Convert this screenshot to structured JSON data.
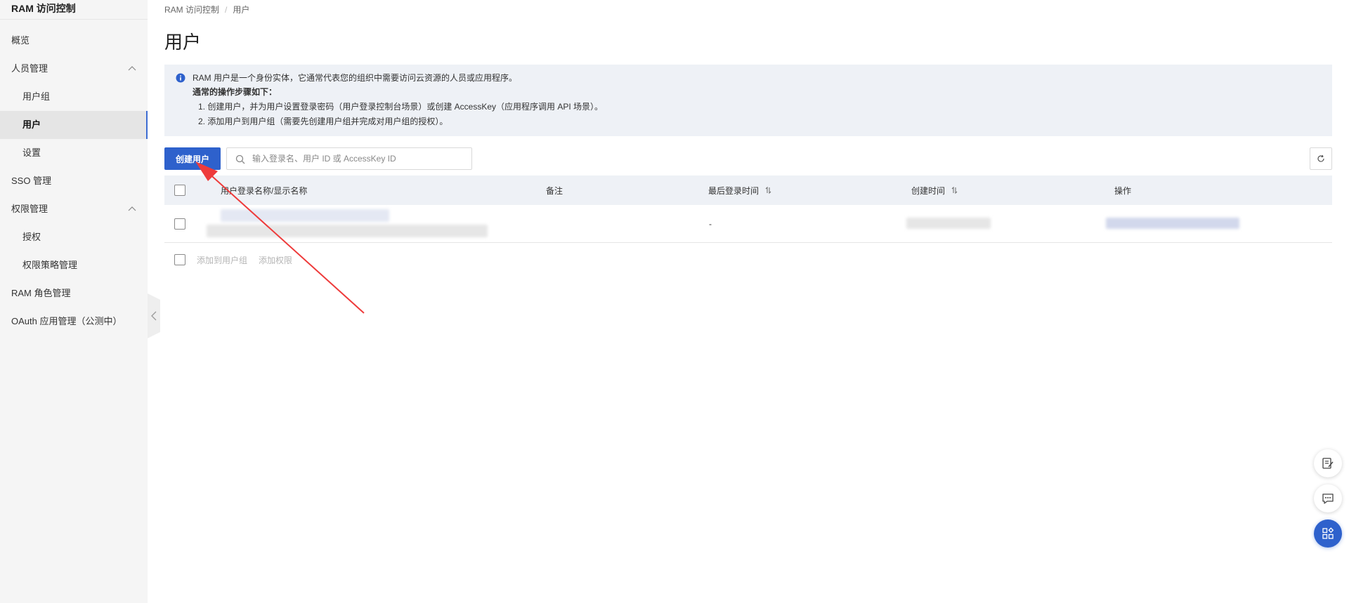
{
  "sidebar": {
    "title": "RAM 访问控制",
    "items": [
      {
        "label": "概览"
      },
      {
        "label": "人员管理"
      },
      {
        "label": "用户组"
      },
      {
        "label": "用户"
      },
      {
        "label": "设置"
      },
      {
        "label": "SSO 管理"
      },
      {
        "label": "权限管理"
      },
      {
        "label": "授权"
      },
      {
        "label": "权限策略管理"
      },
      {
        "label": "RAM 角色管理"
      },
      {
        "label": "OAuth 应用管理（公测中）"
      }
    ]
  },
  "breadcrumb": {
    "root": "RAM 访问控制",
    "separator": "/",
    "current": "用户"
  },
  "page": {
    "title": "用户"
  },
  "notice": {
    "intro": "RAM 用户是一个身份实体，它通常代表您的组织中需要访问云资源的人员或应用程序。",
    "steps_title": "通常的操作步骤如下：",
    "step1": "1. 创建用户，并为用户设置登录密码（用户登录控制台场景）或创建 AccessKey（应用程序调用 API 场景）。",
    "step2": "2. 添加用户到用户组（需要先创建用户组并完成对用户组的授权）。"
  },
  "toolbar": {
    "create_label": "创建用户",
    "search_placeholder": "输入登录名、用户 ID 或 AccessKey ID"
  },
  "table": {
    "columns": {
      "name": "用户登录名称/显示名称",
      "note": "备注",
      "last_login": "最后登录时间",
      "created": "创建时间",
      "actions": "操作"
    },
    "rows": [
      {
        "last_login": "-"
      }
    ]
  },
  "batch": {
    "add_to_group": "添加到用户组",
    "add_permission": "添加权限"
  },
  "colors": {
    "primary": "#2e61cc",
    "sidebar_bg": "#f5f5f5",
    "notice_bg": "#eef1f6",
    "annotation": "#ee3b3b"
  }
}
